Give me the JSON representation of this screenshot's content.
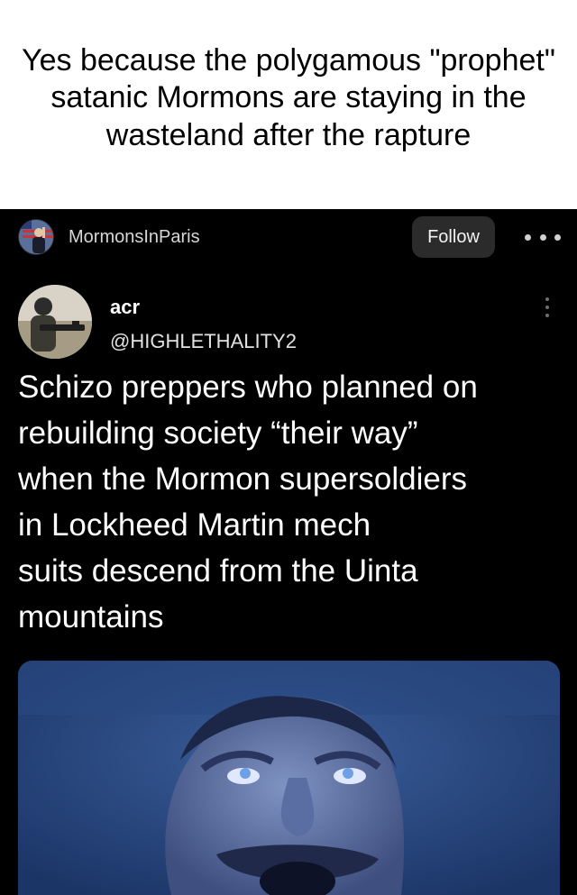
{
  "caption": {
    "text": "Yes because the polygamous \"prophet\" satanic Mormons are staying in the wasteland after the rapture"
  },
  "post": {
    "community": {
      "name": "MormonsInParis",
      "avatar_icon": "community-avatar-icon"
    },
    "follow_label": "Follow",
    "more_icon": "more-horizontal-icon"
  },
  "tweet": {
    "author_name": "acr",
    "author_handle": "@HIGHLETHALITY2",
    "menu_icon": "more-vertical-icon",
    "text": "Schizo preppers who planned on\nrebuilding society “their way”\nwhen the Mormon supersoldiers\nin Lockheed Martin mech\nsuits descend from the Uinta\nmountains"
  },
  "colors": {
    "background": "#000000",
    "caption_background": "#ffffff",
    "follow_button": "#2b2b2b",
    "media_tint": "#24487f"
  }
}
